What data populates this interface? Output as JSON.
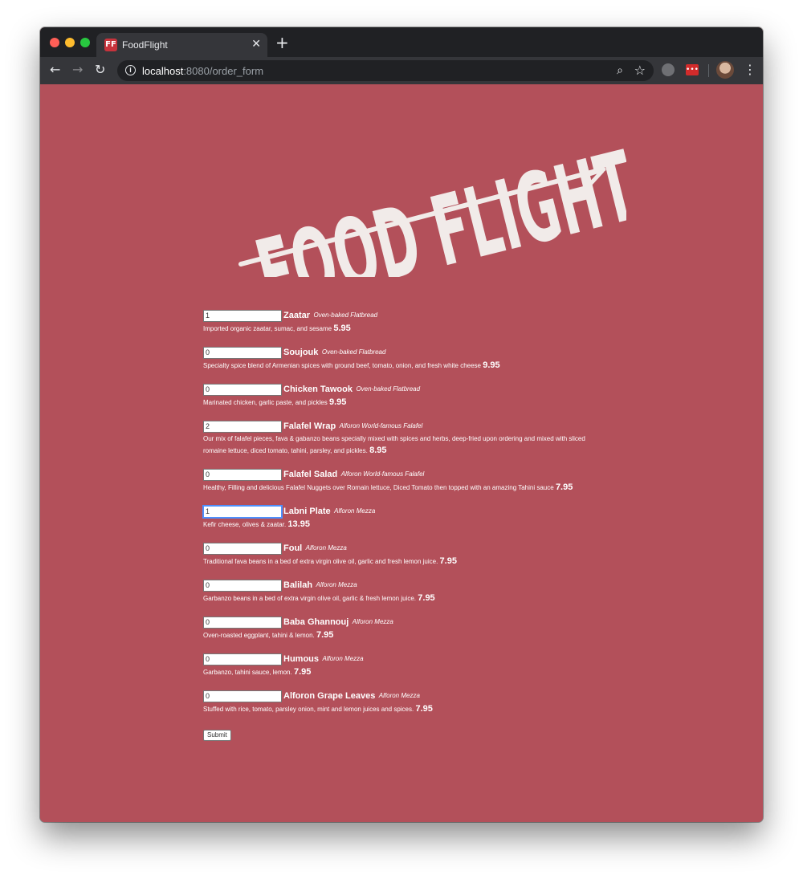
{
  "browser": {
    "tab_title": "FoodFlight",
    "tab_favicon_text": "FF",
    "url_host": "localhost",
    "url_rest": ":8080/order_form"
  },
  "logo": {
    "text": "FOOD FLIGHT"
  },
  "menu": [
    {
      "qty": "1",
      "name": "Zaatar",
      "category": "Oven-baked Flatbread",
      "description": "Imported organic zaatar, sumac, and sesame",
      "price": "5.95"
    },
    {
      "qty": "0",
      "name": "Soujouk",
      "category": "Oven-baked Flatbread",
      "description": "Specialty spice blend of Armenian spices with ground beef, tomato, onion, and fresh white cheese",
      "price": "9.95"
    },
    {
      "qty": "0",
      "name": "Chicken Tawook",
      "category": "Oven-baked Flatbread",
      "description": "Marinated chicken, garlic paste, and pickles",
      "price": "9.95"
    },
    {
      "qty": "2",
      "name": "Falafel Wrap",
      "category": "Alforon World-famous Falafel",
      "description": "Our mix of falafel pieces, fava & gabanzo beans specially mixed with spices and herbs, deep-fried upon ordering and mixed with sliced romaine lettuce, diced tomato, tahini, parsley, and pickles.",
      "price": "8.95"
    },
    {
      "qty": "0",
      "name": "Falafel Salad",
      "category": "Alforon World-famous Falafel",
      "description": "Healthy, Filling and delicious Falafel Nuggets over Romain lettuce, Diced Tomato then topped with an amazing Tahini sauce",
      "price": "7.95"
    },
    {
      "qty": "1",
      "name": "Labni Plate",
      "category": "Alforon Mezza",
      "description": "Kefir cheese, olives & zaatar.",
      "price": "13.95"
    },
    {
      "qty": "0",
      "name": "Foul",
      "category": "Alforon Mezza",
      "description": "Traditional fava beans in a bed of extra virgin olive oil, garlic and fresh lemon juice.",
      "price": "7.95"
    },
    {
      "qty": "0",
      "name": "Balilah",
      "category": "Alforon Mezza",
      "description": "Garbanzo beans in a bed of extra virgin olive oil, garlic & fresh lemon juice.",
      "price": "7.95"
    },
    {
      "qty": "0",
      "name": "Baba Ghannouj",
      "category": "Alforon Mezza",
      "description": "Oven-roasted eggplant, tahini & lemon.",
      "price": "7.95"
    },
    {
      "qty": "0",
      "name": "Humous",
      "category": "Alforon Mezza",
      "description": "Garbanzo, tahini sauce, lemon.",
      "price": "7.95"
    },
    {
      "qty": "0",
      "name": "Alforon Grape Leaves",
      "category": "Alforon Mezza",
      "description": "Stuffed with rice, tomato, parsley onion, mint and lemon juices and spices.",
      "price": "7.95"
    }
  ],
  "submit_label": "Submit",
  "colors": {
    "page_bg": "#b3505a",
    "text": "#ffffff"
  },
  "icons": [
    "back-arrow-icon",
    "forward-arrow-icon",
    "reload-icon",
    "info-icon",
    "zoom-icon",
    "star-icon",
    "extension-icon",
    "menu-dots-icon"
  ]
}
